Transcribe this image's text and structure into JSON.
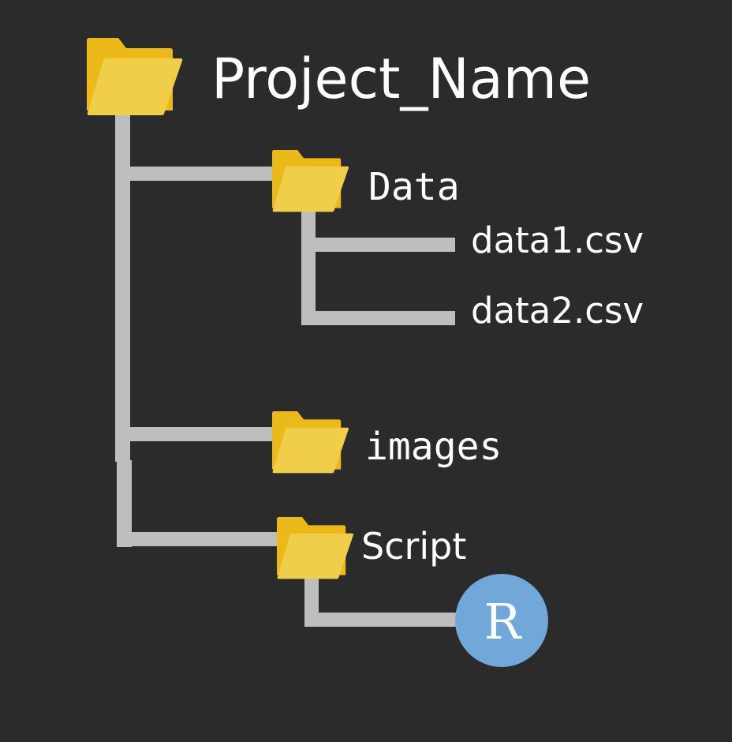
{
  "root": {
    "label": "Project_Name",
    "icon": "folder-icon"
  },
  "folders": [
    {
      "label": "Data",
      "icon": "folder-icon",
      "files": [
        "data1.csv",
        "data2.csv"
      ]
    },
    {
      "label": "images",
      "icon": "folder-icon"
    },
    {
      "label": "Script",
      "icon": "folder-icon",
      "files": [
        "R"
      ]
    }
  ],
  "colors": {
    "background": "#2b2b2b",
    "connector": "#bebebe",
    "folder_back": "#ebb91a",
    "folder_front": "#f0ce4a",
    "r_badge": "#72a7da"
  }
}
